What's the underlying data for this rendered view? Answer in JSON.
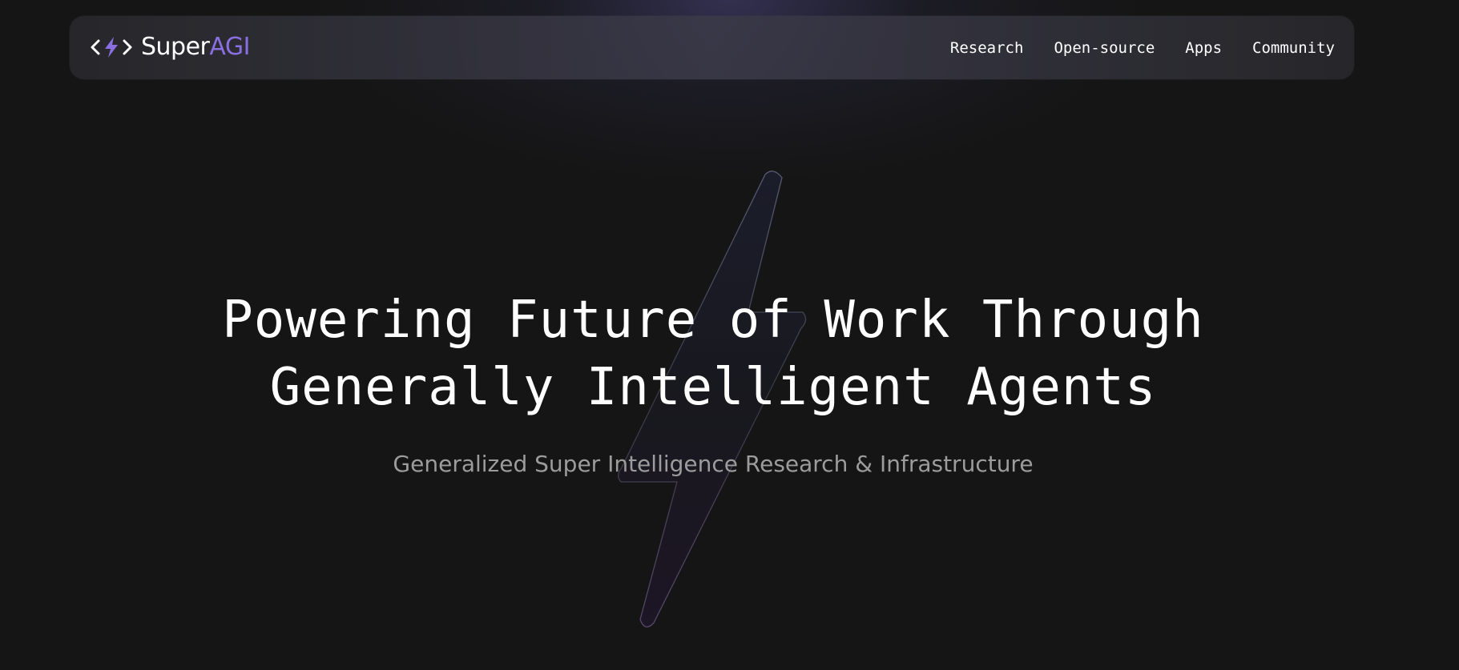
{
  "brand": {
    "name_primary": "Super",
    "name_accent": "AGI",
    "accent_color": "#8a6fe0",
    "logo_icon": "code-bolt-icon"
  },
  "nav": {
    "items": [
      {
        "label": "Research"
      },
      {
        "label": "Open-source"
      },
      {
        "label": "Apps"
      },
      {
        "label": "Community"
      }
    ]
  },
  "hero": {
    "title_line1": "Powering Future of Work Through",
    "title_line2": "Generally Intelligent Agents",
    "subtitle": "Generalized Super Intelligence Research & Infrastructure",
    "background_icon": "lightning-bolt-icon"
  },
  "colors": {
    "background": "#151515",
    "text": "#ffffff",
    "subtitle": "#9c9c9c"
  }
}
